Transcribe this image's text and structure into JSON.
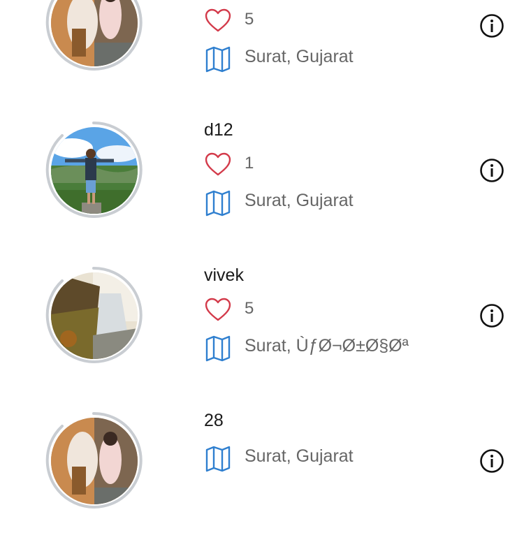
{
  "feed": [
    {
      "name": "",
      "likes": "5",
      "location": "Surat, Gujarat",
      "avatar": "couple-photo"
    },
    {
      "name": "d12",
      "likes": "1",
      "location": "Surat, Gujarat",
      "avatar": "man-on-cliff-photo"
    },
    {
      "name": "vivek",
      "likes": "5",
      "location": "Surat, ÙƒØ¬Ø±Ø§Øª",
      "avatar": "waterfall-photo"
    },
    {
      "name": "28",
      "likes": "",
      "location": "Surat, Gujarat",
      "avatar": "couple-photo"
    }
  ],
  "icons": {
    "like": "heart-icon",
    "location": "map-icon",
    "info": "info-icon"
  },
  "colors": {
    "heart": "#d33a4a",
    "map": "#2f7fcf",
    "ring": "#c9cdd2",
    "text_muted": "#666666"
  }
}
